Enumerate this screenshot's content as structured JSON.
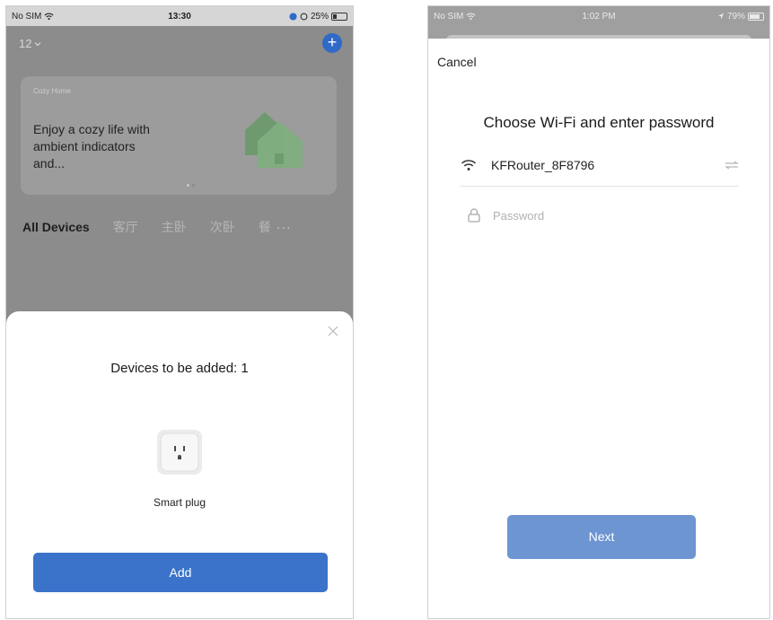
{
  "left_screen": {
    "status_bar": {
      "carrier": "No SIM",
      "time": "13:30",
      "battery": "25%"
    },
    "home_selector": {
      "label": "12"
    },
    "add_button_label": "+",
    "promo_card": {
      "small_title": "Cozy Home",
      "text": "Enjoy a cozy life with ambient indicators and..."
    },
    "room_tabs": [
      {
        "label": "All Devices"
      },
      {
        "label": "客厅"
      },
      {
        "label": "主卧"
      },
      {
        "label": "次卧"
      },
      {
        "label": "餐"
      }
    ],
    "more_label": "···",
    "sheet": {
      "title": "Devices to be added: 1",
      "device_label": "Smart plug",
      "add_label": "Add"
    }
  },
  "right_screen": {
    "status_bar": {
      "carrier": "No SIM",
      "time": "1:02 PM",
      "battery": "79%"
    },
    "cancel_label": "Cancel",
    "title": "Choose Wi-Fi and enter password",
    "wifi_name": "KFRouter_8F8796",
    "password_placeholder": "Password",
    "next_label": "Next"
  },
  "colors": {
    "accent_blue": "#3a73c9",
    "next_blue": "#6d95d2",
    "overlay_gray": "#8c8c8c"
  },
  "icons": [
    "wifi-icon",
    "location-icon",
    "battery-icon",
    "chevron-down-icon",
    "plus-icon",
    "house-icon",
    "close-icon",
    "power-outlet-icon",
    "swap-icon",
    "lock-icon"
  ]
}
